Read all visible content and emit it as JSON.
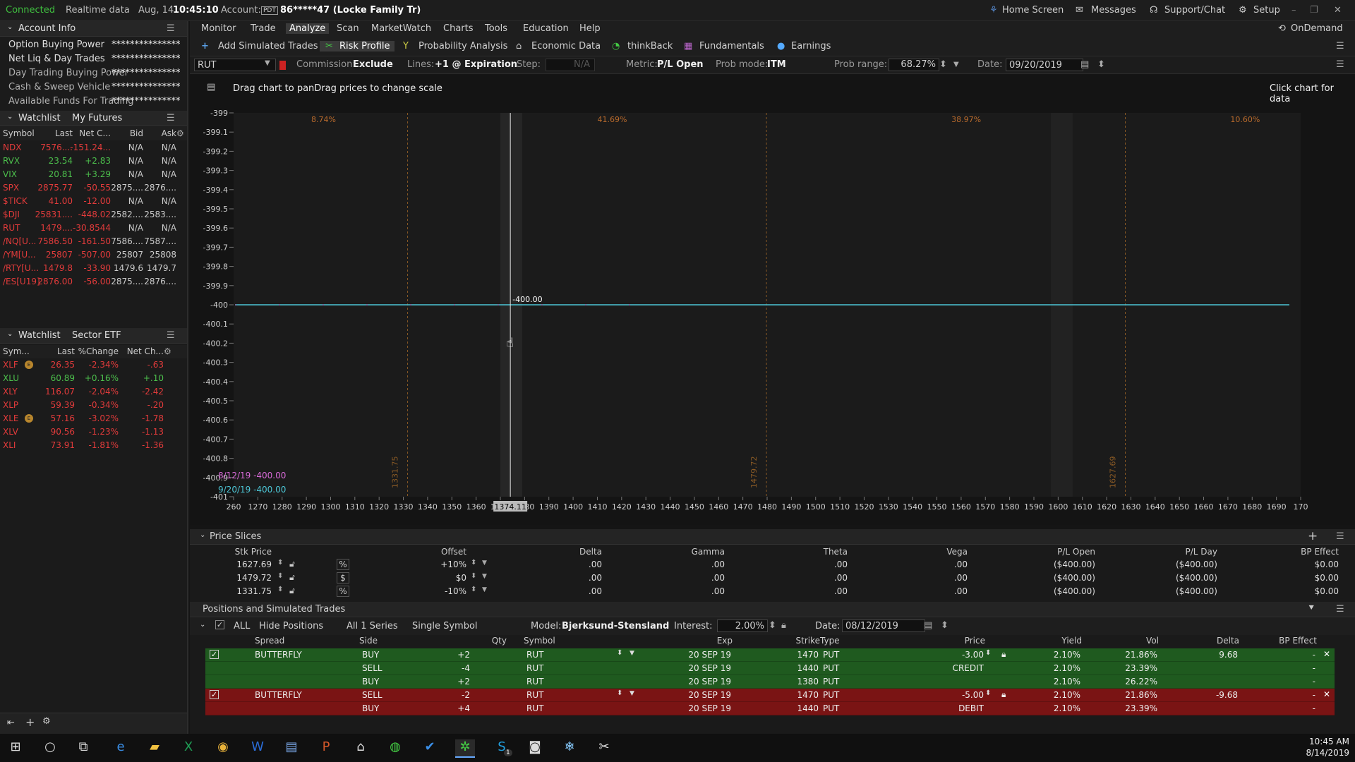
{
  "status": {
    "connected": "Connected",
    "realtime": "Realtime data",
    "date": "Aug, 14",
    "time": "10:45:10",
    "account_label": "Account:",
    "account_tag": "PDT",
    "account_value": "86*****47 (Locke Family Tr)",
    "home": "Home Screen",
    "messages": "Messages",
    "support": "Support/Chat",
    "setup": "Setup"
  },
  "account": {
    "title": "Account Info",
    "rows": [
      {
        "label": "Option Buying Power",
        "value": "***************"
      },
      {
        "label": "Net Liq & Day Trades",
        "value": "***************"
      },
      {
        "label": "Day Trading Buying Power",
        "value": "***************"
      },
      {
        "label": "Cash & Sweep Vehicle",
        "value": "***************"
      },
      {
        "label": "Available Funds For Trading",
        "value": "***************"
      }
    ]
  },
  "watchlist1": {
    "title": "Watchlist",
    "name": "My Futures",
    "cols": [
      "Symbol",
      "Last",
      "Net C...",
      "Bid",
      "Ask"
    ],
    "rows": [
      {
        "sym": "NDX",
        "last": "7576....",
        "net": "-151.24...",
        "bid": "N/A",
        "ask": "N/A",
        "c": "red"
      },
      {
        "sym": "RVX",
        "last": "23.54",
        "net": "+2.83",
        "bid": "N/A",
        "ask": "N/A",
        "c": "green"
      },
      {
        "sym": "VIX",
        "last": "20.81",
        "net": "+3.29",
        "bid": "N/A",
        "ask": "N/A",
        "c": "green"
      },
      {
        "sym": "SPX",
        "last": "2875.77",
        "net": "-50.55",
        "bid": "2875....",
        "ask": "2876....",
        "c": "red"
      },
      {
        "sym": "$TICK",
        "last": "41.00",
        "net": "-12.00",
        "bid": "N/A",
        "ask": "N/A",
        "c": "red"
      },
      {
        "sym": "$DJI",
        "last": "25831....",
        "net": "-448.02",
        "bid": "2582....",
        "ask": "2583....",
        "c": "red"
      },
      {
        "sym": "RUT",
        "last": "1479....",
        "net": "-30.8544",
        "bid": "N/A",
        "ask": "N/A",
        "c": "red"
      },
      {
        "sym": "/NQ[U...",
        "last": "7586.50",
        "net": "-161.50",
        "bid": "7586....",
        "ask": "7587....",
        "c": "red"
      },
      {
        "sym": "/YM[U...",
        "last": "25807",
        "net": "-507.00",
        "bid": "25807",
        "ask": "25808",
        "c": "red"
      },
      {
        "sym": "/RTY[U...",
        "last": "1479.8",
        "net": "-33.90",
        "bid": "1479.6",
        "ask": "1479.7",
        "c": "red"
      },
      {
        "sym": "/ES[U19]",
        "last": "2876.00",
        "net": "-56.00",
        "bid": "2875....",
        "ask": "2876....",
        "c": "red"
      }
    ]
  },
  "watchlist2": {
    "title": "Watchlist",
    "name": "Sector ETF",
    "cols": [
      "Sym...",
      "Last",
      "%Change",
      "Net Ch..."
    ],
    "rows": [
      {
        "sym": "XLF",
        "last": "26.35",
        "pct": "-2.34%",
        "net": "-.63",
        "c": "red",
        "badge": true
      },
      {
        "sym": "XLU",
        "last": "60.89",
        "pct": "+0.16%",
        "net": "+.10",
        "c": "green",
        "badge": false
      },
      {
        "sym": "XLY",
        "last": "116.07",
        "pct": "-2.04%",
        "net": "-2.42",
        "c": "red",
        "badge": false
      },
      {
        "sym": "XLP",
        "last": "59.39",
        "pct": "-0.34%",
        "net": "-.20",
        "c": "red",
        "badge": false
      },
      {
        "sym": "XLE",
        "last": "57.16",
        "pct": "-3.02%",
        "net": "-1.78",
        "c": "red",
        "badge": true
      },
      {
        "sym": "XLV",
        "last": "90.56",
        "pct": "-1.23%",
        "net": "-1.13",
        "c": "red",
        "badge": false
      },
      {
        "sym": "XLI",
        "last": "73.91",
        "pct": "-1.81%",
        "net": "-1.36",
        "c": "red",
        "badge": false
      }
    ]
  },
  "menu": {
    "items": [
      "Monitor",
      "Trade",
      "Analyze",
      "Scan",
      "MarketWatch",
      "Charts",
      "Tools",
      "Education",
      "Help"
    ],
    "ondemand": "OnDemand"
  },
  "toolbar": {
    "add": "Add Simulated Trades",
    "risk": "Risk Profile",
    "prob": "Probability Analysis",
    "econ": "Economic Data",
    "think": "thinkBack",
    "fund": "Fundamentals",
    "earn": "Earnings"
  },
  "options": {
    "symbol": "RUT",
    "commission_label": "Commission:",
    "commission": "Exclude",
    "lines_label": "Lines:",
    "lines": "+1 @ Expiration",
    "step_label": "Step:",
    "step": "N/A",
    "metric_label": "Metric:",
    "metric": "P/L Open",
    "probmode_label": "Prob mode:",
    "probmode": "ITM",
    "probrange_label": "Prob range:",
    "probrange": "68.27%",
    "date_label": "Date:",
    "date": "09/20/2019"
  },
  "chart": {
    "hint": "Drag chart to panDrag prices to change scale",
    "click": "Click chart for data",
    "cursor_price": "1374.11",
    "line_label": "-400.00",
    "legend1": "8/12/19 -400.00",
    "legend2": "9/20/19 -400.00",
    "pcts": [
      "8.74%",
      "41.69%",
      "38.97%",
      "10.60%"
    ],
    "vlabels": [
      "1331.75",
      "1479.72",
      "1627.69"
    ]
  },
  "chart_data": {
    "type": "line",
    "xlabel": "",
    "ylabel": "",
    "xlim": [
      1260,
      1700
    ],
    "ylim": [
      -401,
      -399
    ],
    "yticks": [
      "-399",
      "-399.1",
      "-399.2",
      "-399.3",
      "-399.4",
      "-399.5",
      "-399.6",
      "-399.7",
      "-399.8",
      "-399.9",
      "-400",
      "-400.1",
      "-400.2",
      "-400.3",
      "-400.4",
      "-400.5",
      "-400.6",
      "-400.7",
      "-400.8",
      "-400.9",
      "-401"
    ],
    "xticks": [
      "260",
      "1270",
      "1280",
      "1290",
      "1300",
      "1310",
      "1320",
      "1330",
      "1340",
      "1350",
      "1360",
      "1370",
      "1380",
      "1390",
      "1400",
      "1410",
      "1420",
      "1430",
      "1440",
      "1450",
      "1460",
      "1470",
      "1480",
      "1490",
      "1500",
      "1510",
      "1520",
      "1530",
      "1540",
      "1550",
      "1560",
      "1570",
      "1580",
      "1590",
      "1600",
      "1610",
      "1620",
      "1630",
      "1640",
      "1650",
      "1660",
      "1670",
      "1680",
      "1690",
      "170"
    ],
    "series": [
      {
        "name": "",
        "x": [
          1260,
          1700
        ],
        "values": [
          -400,
          -400
        ]
      }
    ],
    "vlines": [
      1331.75,
      1479.72,
      1627.69
    ],
    "cursor": 1374.11
  },
  "slices": {
    "title": "Price Slices",
    "cols": [
      "Stk Price",
      "Offset",
      "Delta",
      "Gamma",
      "Theta",
      "Vega",
      "P/L Open",
      "P/L Day",
      "BP Effect"
    ],
    "rows": [
      {
        "stk": "1627.69",
        "unit": "%",
        "offset": "+10%",
        "delta": ".00",
        "gamma": ".00",
        "theta": ".00",
        "vega": ".00",
        "plo": "($400.00)",
        "pld": "($400.00)",
        "bp": "$0.00"
      },
      {
        "stk": "1479.72",
        "unit": "$",
        "offset": "$0",
        "delta": ".00",
        "gamma": ".00",
        "theta": ".00",
        "vega": ".00",
        "plo": "($400.00)",
        "pld": "($400.00)",
        "bp": "$0.00"
      },
      {
        "stk": "1331.75",
        "unit": "%",
        "offset": "-10%",
        "delta": ".00",
        "gamma": ".00",
        "theta": ".00",
        "vega": ".00",
        "plo": "($400.00)",
        "pld": "($400.00)",
        "bp": "$0.00"
      }
    ]
  },
  "positions": {
    "title": "Positions and Simulated Trades",
    "all": "ALL",
    "hide": "Hide Positions",
    "series": "All 1 Series",
    "single": "Single Symbol",
    "model_label": "Model:",
    "model": "Bjerksund-Stensland",
    "interest_label": "Interest:",
    "interest": "2.00%",
    "date_label": "Date:",
    "date": "08/12/2019",
    "cols": [
      "Spread",
      "Side",
      "Qty",
      "Symbol",
      "Exp",
      "Strike",
      "Type",
      "Price",
      "Yield",
      "Vol",
      "Delta",
      "BP Effect"
    ],
    "rows": [
      {
        "spread": "BUTTERFLY",
        "side": "BUY",
        "qty": "+2",
        "sym": "RUT",
        "exp": "20 SEP 19",
        "strike": "1470",
        "type": "PUT",
        "price": "-3.00",
        "yield": "2.10%",
        "vol": "21.86%",
        "delta": "9.68",
        "bp": "-",
        "c": "g",
        "first": true
      },
      {
        "spread": "",
        "side": "SELL",
        "qty": "-4",
        "sym": "RUT",
        "exp": "20 SEP 19",
        "strike": "1440",
        "type": "PUT",
        "price": "CREDIT",
        "yield": "2.10%",
        "vol": "23.39%",
        "delta": "",
        "bp": "-",
        "c": "g",
        "first": false
      },
      {
        "spread": "",
        "side": "BUY",
        "qty": "+2",
        "sym": "RUT",
        "exp": "20 SEP 19",
        "strike": "1380",
        "type": "PUT",
        "price": "",
        "yield": "2.10%",
        "vol": "26.22%",
        "delta": "",
        "bp": "-",
        "c": "g",
        "first": false
      },
      {
        "spread": "BUTTERFLY",
        "side": "SELL",
        "qty": "-2",
        "sym": "RUT",
        "exp": "20 SEP 19",
        "strike": "1470",
        "type": "PUT",
        "price": "-5.00",
        "yield": "2.10%",
        "vol": "21.86%",
        "delta": "-9.68",
        "bp": "-",
        "c": "r",
        "first": true
      },
      {
        "spread": "",
        "side": "BUY",
        "qty": "+4",
        "sym": "RUT",
        "exp": "20 SEP 19",
        "strike": "1440",
        "type": "PUT",
        "price": "DEBIT",
        "yield": "2.10%",
        "vol": "23.39%",
        "delta": "",
        "bp": "-",
        "c": "r",
        "first": false
      }
    ]
  },
  "taskbar": {
    "time": "10:45 AM",
    "date": "8/14/2019",
    "skype_badge": "1"
  }
}
